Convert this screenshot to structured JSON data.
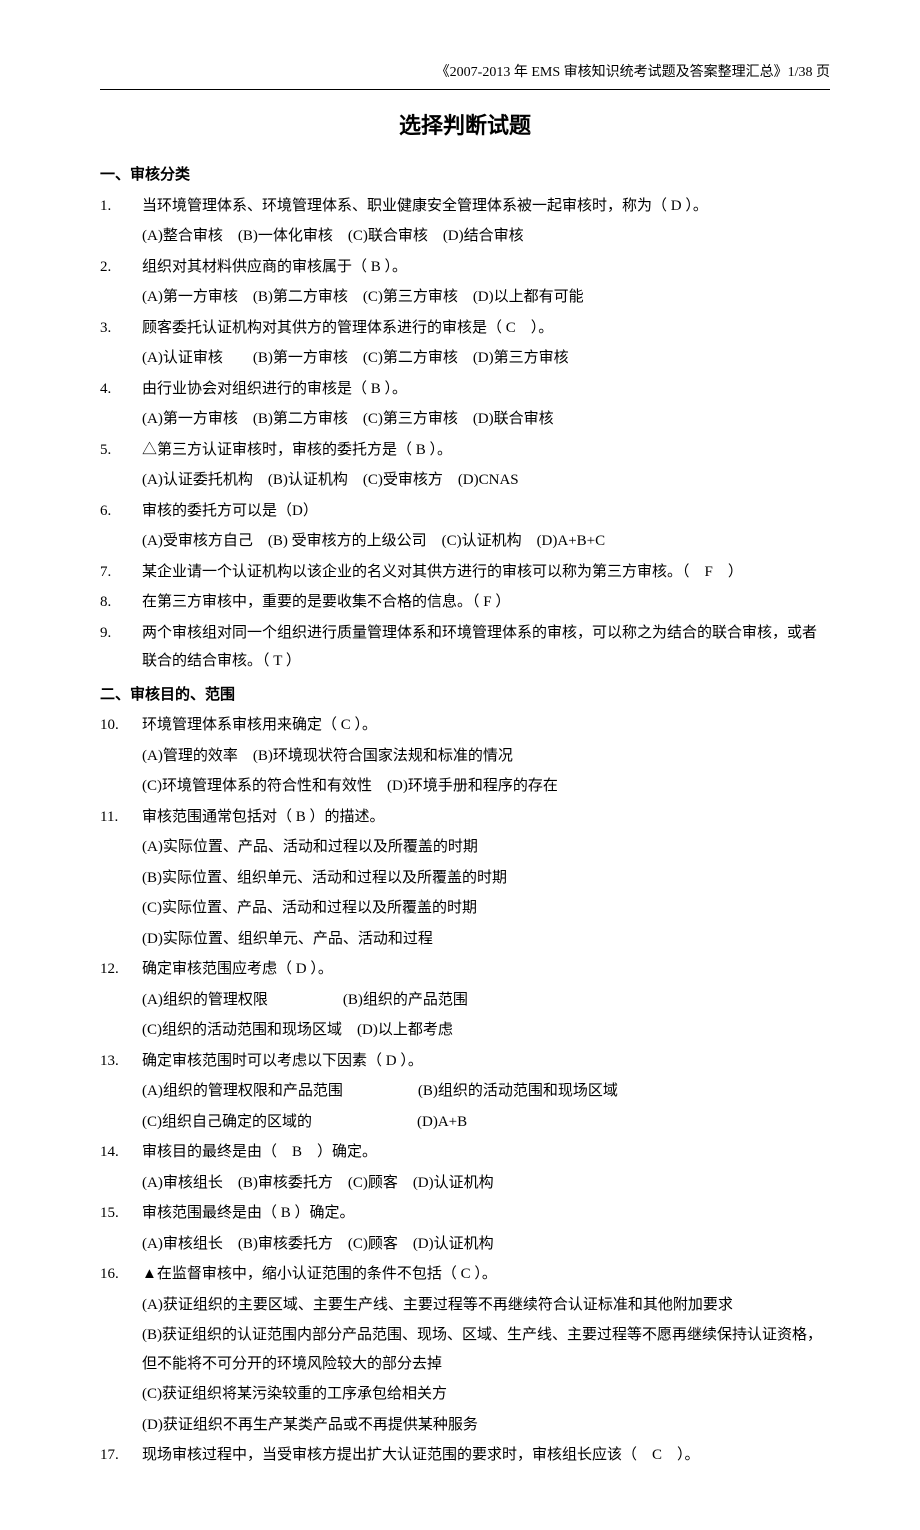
{
  "header": "《2007-2013 年 EMS 审核知识统考试题及答案整理汇总》1/38 页",
  "title": "选择判断试题",
  "section1": {
    "head": "一、审核分类",
    "q1": {
      "num": "1.",
      "text": "当环境管理体系、环境管理体系、职业健康安全管理体系被一起审核时，称为（ D ）。",
      "opts": "(A)整合审核　(B)一体化审核　(C)联合审核　(D)结合审核"
    },
    "q2": {
      "num": "2.",
      "text": "组织对其材料供应商的审核属于（ B  ）。",
      "opts": "(A)第一方审核　(B)第二方审核　(C)第三方审核　(D)以上都有可能"
    },
    "q3": {
      "num": "3.",
      "text": "顾客委托认证机构对其供方的管理体系进行的审核是（ C　）。",
      "opts": "(A)认证审核　　(B)第一方审核　(C)第二方审核　(D)第三方审核"
    },
    "q4": {
      "num": "4.",
      "text": "由行业协会对组织进行的审核是（ B  ）。",
      "opts": "(A)第一方审核　(B)第二方审核　(C)第三方审核　(D)联合审核"
    },
    "q5": {
      "num": "5.",
      "text": "△第三方认证审核时，审核的委托方是（ B  ）。",
      "opts": "(A)认证委托机构　(B)认证机构　(C)受审核方　(D)CNAS"
    },
    "q6": {
      "num": "6.",
      "text": "审核的委托方可以是（D）",
      "opts": "(A)受审核方自己　(B) 受审核方的上级公司　(C)认证机构　(D)A+B+C"
    },
    "q7": {
      "num": "7.",
      "text": "某企业请一个认证机构以该企业的名义对其供方进行的审核可以称为第三方审核。（　F　）"
    },
    "q8": {
      "num": "8.",
      "text": "在第三方审核中，重要的是要收集不合格的信息。（  F  ）"
    },
    "q9": {
      "num": "9.",
      "text": "两个审核组对同一个组织进行质量管理体系和环境管理体系的审核，可以称之为结合的联合审核，或者联合的结合审核。（  T  ）"
    }
  },
  "section2": {
    "head": "二、审核目的、范围",
    "q10": {
      "num": "10.",
      "text": "环境管理体系审核用来确定（ C ）。",
      "opt1": "(A)管理的效率　(B)环境现状符合国家法规和标准的情况",
      "opt2": "(C)环境管理体系的符合性和有效性　(D)环境手册和程序的存在"
    },
    "q11": {
      "num": "11.",
      "text": "审核范围通常包括对（ B  ）的描述。",
      "opt1": "(A)实际位置、产品、活动和过程以及所覆盖的时期",
      "opt2": "(B)实际位置、组织单元、活动和过程以及所覆盖的时期",
      "opt3": "(C)实际位置、产品、活动和过程以及所覆盖的时期",
      "opt4": "(D)实际位置、组织单元、产品、活动和过程"
    },
    "q12": {
      "num": "12.",
      "text": "确定审核范围应考虑（ D ）。",
      "opt1": "(A)组织的管理权限　　　　　(B)组织的产品范围",
      "opt2": "(C)组织的活动范围和现场区域　(D)以上都考虑"
    },
    "q13": {
      "num": "13.",
      "text": "确定审核范围时可以考虑以下因素（ D  ）。",
      "opt1": "(A)组织的管理权限和产品范围　　　　　(B)组织的活动范围和现场区域",
      "opt2": "(C)组织自己确定的区域的　　　　　　　(D)A+B"
    },
    "q14": {
      "num": "14.",
      "text": "审核目的最终是由（　B　）确定。",
      "opts": "(A)审核组长　(B)审核委托方　(C)顾客　(D)认证机构"
    },
    "q15": {
      "num": "15.",
      "text": "审核范围最终是由（ B  ）确定。",
      "opts": "(A)审核组长　(B)审核委托方　(C)顾客　(D)认证机构"
    },
    "q16": {
      "num": "16.",
      "text": "▲在监督审核中，缩小认证范围的条件不包括（ C  ）。",
      "opt1": "(A)获证组织的主要区域、主要生产线、主要过程等不再继续符合认证标准和其他附加要求",
      "opt2": "(B)获证组织的认证范围内部分产品范围、现场、区域、生产线、主要过程等不愿再继续保持认证资格，但不能将不可分开的环境风险较大的部分去掉",
      "opt3": "(C)获证组织将某污染较重的工序承包给相关方",
      "opt4": "(D)获证组织不再生产某类产品或不再提供某种服务"
    },
    "q17": {
      "num": "17.",
      "text": "现场审核过程中，当受审核方提出扩大认证范围的要求时，审核组长应该（　C　）。"
    }
  }
}
